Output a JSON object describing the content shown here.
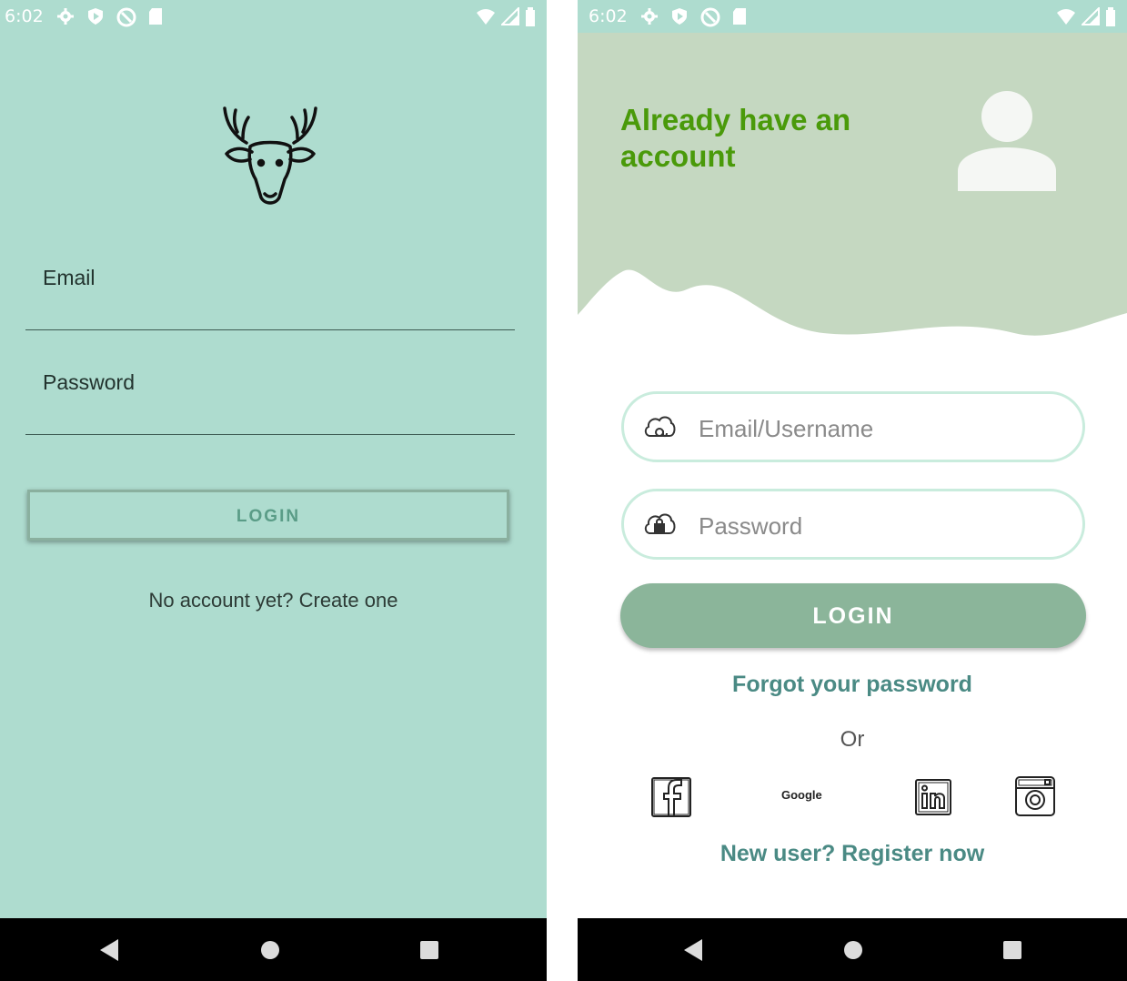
{
  "left_screen": {
    "status_bar": {
      "time": "6:02"
    },
    "email_label": "Email",
    "password_label": "Password",
    "login_button": "LOGIN",
    "create_account_link": "No account yet? Create one",
    "colors": {
      "background": "#aedccf",
      "button_text": "#5a9c87"
    }
  },
  "right_screen": {
    "status_bar": {
      "time": "6:02"
    },
    "header_title": "Already have an account",
    "email_placeholder": "Email/Username",
    "password_placeholder": "Password",
    "login_button": "LOGIN",
    "forgot_password_link": "Forgot your password",
    "or_text": "Or",
    "social_icons": [
      "facebook-icon",
      "google-icon",
      "linkedin-icon",
      "instagram-icon"
    ],
    "google_label": "Google",
    "register_link": "New user? Register now",
    "colors": {
      "header_bg": "#c5d8c1",
      "title": "#4a9a0a",
      "login_button": "#8bb59a",
      "link": "#4a8a84",
      "input_border": "#c9ecdd"
    }
  }
}
